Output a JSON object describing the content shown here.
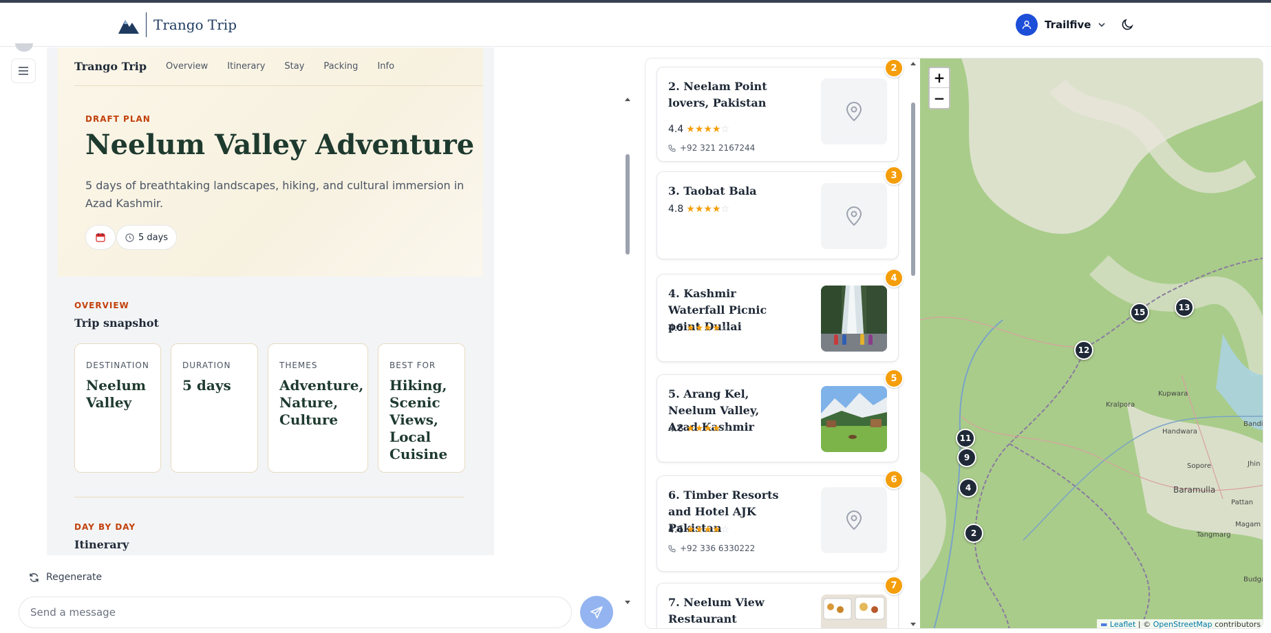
{
  "header": {
    "brand": "Trango Trip",
    "user_name": "Trailfive"
  },
  "doc": {
    "nav": {
      "brand": "Trango Trip",
      "items": [
        "Overview",
        "Itinerary",
        "Stay",
        "Packing",
        "Info"
      ]
    },
    "eyebrow": "DRAFT PLAN",
    "title": "Neelum Valley Adventure",
    "description": "5 days of breathtaking landscapes, hiking, and cultural immersion in Azad Kashmir.",
    "duration_chip": "5 days",
    "overview": {
      "eyebrow": "OVERVIEW",
      "title": "Trip snapshot",
      "cards": [
        {
          "label": "DESTINATION",
          "value": "Neelum Valley"
        },
        {
          "label": "DURATION",
          "value": "5 days"
        },
        {
          "label": "THEMES",
          "value": "Adventure, Nature, Culture"
        },
        {
          "label": "BEST FOR",
          "value": "Hiking, Scenic Views, Local Cuisine"
        }
      ]
    },
    "itinerary": {
      "eyebrow": "DAY BY DAY",
      "title": "Itinerary"
    }
  },
  "chat": {
    "regenerate": "Regenerate",
    "placeholder": "Send a message"
  },
  "places": [
    {
      "badge": "2",
      "name": "2. Neelam Point lovers, Pakistan",
      "rating": "4.4",
      "stars": 4,
      "phone": "+92 321 2167244",
      "image": "placeholder"
    },
    {
      "badge": "3",
      "name": "3. Taobat Bala",
      "rating": "4.8",
      "stars": 4,
      "phone": "",
      "image": "placeholder"
    },
    {
      "badge": "4",
      "name": "4. Kashmir Waterfall Picnic point Dullai",
      "rating": "4.5",
      "stars": 4,
      "phone": "",
      "image": "waterfall"
    },
    {
      "badge": "5",
      "name": "5. Arang Kel, Neelum Valley, Azad Kashmir",
      "rating": "4.8",
      "stars": 4,
      "phone": "",
      "image": "meadow"
    },
    {
      "badge": "6",
      "name": "6. Timber Resorts and Hotel AJK Pakistan",
      "rating": "4.6",
      "stars": 4,
      "phone": "+92 336 6330222",
      "image": "placeholder"
    },
    {
      "badge": "7",
      "name": "7. Neelum View Restaurant",
      "rating": "",
      "stars": 0,
      "phone": "",
      "image": "food"
    }
  ],
  "map": {
    "zoom_in": "+",
    "zoom_out": "−",
    "markers": [
      "15",
      "13",
      "12",
      "11",
      "9",
      "4",
      "2"
    ],
    "labels": [
      "Kralpora",
      "Kupwara",
      "Handwara",
      "Sopore",
      "Baramulla",
      "Pattan",
      "Tangmarg",
      "Magam",
      "Bandip",
      "Jhin",
      "Budga"
    ],
    "attribution": {
      "leaflet": "Leaflet",
      "sep": " | © ",
      "osm": "OpenStreetMap",
      "tail": " contributors"
    }
  }
}
